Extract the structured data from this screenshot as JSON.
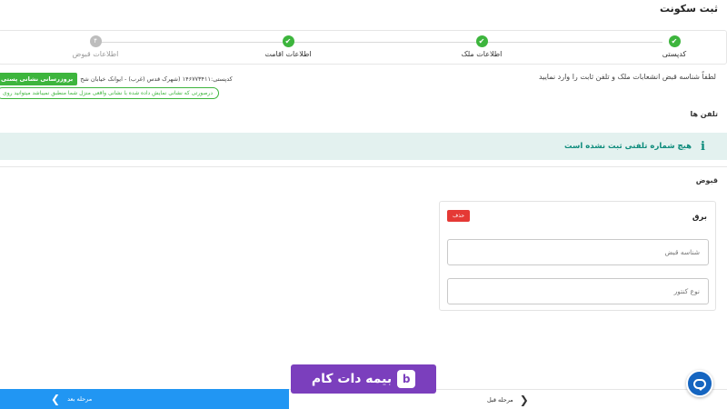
{
  "page": {
    "title": "ثبت سکونت"
  },
  "stepper": {
    "steps": [
      {
        "label": "کدپستی",
        "status": "done",
        "icon": "check-icon"
      },
      {
        "label": "اطلاعات ملک",
        "status": "done",
        "icon": "check-icon"
      },
      {
        "label": "اطلاعات اقامت",
        "status": "done",
        "icon": "check-icon"
      },
      {
        "label": "اطلاعات قبوض",
        "status": "pending",
        "number": "۴"
      }
    ]
  },
  "instructions": "لطفاً شناسه قبض انشعابات ملک و تلفن ثابت را وارد نمایید",
  "postal": {
    "info": "کدپستی:۱۴۶۷۷۳۴۱۱ (شهرک قدس (غرب) - ایوانک خیابان شح",
    "update_button": "بروزرسانی نشانی پستی",
    "map_note": "درصورتی که نشانی نمایش داده شده با نشانی واقعی منزل شما منطبق نمیباشد میتوانید روی"
  },
  "phones": {
    "title": "تلفن ها",
    "empty_message": "هیچ شماره تلفنی ثبت نشده است"
  },
  "bills": {
    "title": "قبوض",
    "card": {
      "title": "برق",
      "delete_label": "حذف",
      "bill_id_placeholder": "شناسه قبض",
      "meter_type_placeholder": "نوع کنتور"
    }
  },
  "footer": {
    "next_label": "مرحله بعد",
    "prev_label": "مرحله قبل"
  },
  "watermark": {
    "text": "بیمه دات کام",
    "badge": "b"
  },
  "colors": {
    "step_done": "#3db53d",
    "primary": "#2196f3",
    "alert_bg": "#e3f1ef",
    "alert_text": "#0a8a7a",
    "danger": "#e53935",
    "watermark": "#7b3fbd"
  }
}
